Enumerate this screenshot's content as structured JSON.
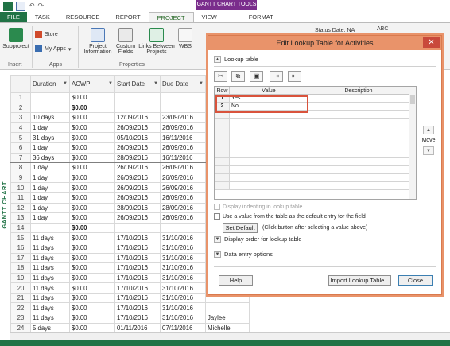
{
  "ribbon": {
    "contextual_tab": "GANTT CHART TOOLS",
    "tabs": [
      "FILE",
      "TASK",
      "RESOURCE",
      "REPORT",
      "PROJECT",
      "VIEW",
      "FORMAT"
    ],
    "active_tab": "PROJECT",
    "buttons": {
      "subproject": "Subproject",
      "store": "Store",
      "my_apps": "My Apps",
      "project_information": "Project Information",
      "custom_fields": "Custom Fields",
      "links_between_projects": "Links Between Projects",
      "wbs": "WBS",
      "status_date_label": "Status Date:",
      "status_date_value": "NA",
      "abc": "ABC"
    },
    "groups": {
      "insert": "Insert",
      "apps": "Apps",
      "properties": "Properties"
    }
  },
  "grid": {
    "side_label": "GANTT CHART",
    "columns": [
      "Duration",
      "ACWP",
      "Start Date",
      "Due Date"
    ],
    "rows": [
      {
        "n": "1",
        "duration": "",
        "acwp": "$0.00",
        "start": "",
        "due": "",
        "bold": false
      },
      {
        "n": "2",
        "duration": "",
        "acwp": "$0.00",
        "start": "",
        "due": "",
        "bold": true
      },
      {
        "n": "3",
        "duration": "10 days",
        "acwp": "$0.00",
        "start": "12/09/2016",
        "due": "23/09/2016",
        "bold": false
      },
      {
        "n": "4",
        "duration": "1 day",
        "acwp": "$0.00",
        "start": "26/09/2016",
        "due": "26/09/2016",
        "bold": false
      },
      {
        "n": "5",
        "duration": "31 days",
        "acwp": "$0.00",
        "start": "05/10/2016",
        "due": "16/11/2016",
        "bold": false
      },
      {
        "n": "6",
        "duration": "1 day",
        "acwp": "$0.00",
        "start": "26/09/2016",
        "due": "26/09/2016",
        "bold": false
      },
      {
        "n": "7",
        "duration": "36 days",
        "acwp": "$0.00",
        "start": "28/09/2016",
        "due": "16/11/2016",
        "bold": false
      },
      {
        "n": "8",
        "duration": "1 day",
        "acwp": "$0.00",
        "start": "26/09/2016",
        "due": "26/09/2016",
        "bold": false
      },
      {
        "n": "9",
        "duration": "1 day",
        "acwp": "$0.00",
        "start": "26/09/2016",
        "due": "26/09/2016",
        "bold": false
      },
      {
        "n": "10",
        "duration": "1 day",
        "acwp": "$0.00",
        "start": "26/09/2016",
        "due": "26/09/2016",
        "bold": false
      },
      {
        "n": "11",
        "duration": "1 day",
        "acwp": "$0.00",
        "start": "26/09/2016",
        "due": "26/09/2016",
        "bold": false
      },
      {
        "n": "12",
        "duration": "1 day",
        "acwp": "$0.00",
        "start": "28/09/2016",
        "due": "28/09/2016",
        "bold": false
      },
      {
        "n": "13",
        "duration": "1 day",
        "acwp": "$0.00",
        "start": "26/09/2016",
        "due": "26/09/2016",
        "bold": false
      },
      {
        "n": "14",
        "duration": "",
        "acwp": "$0.00",
        "start": "",
        "due": "",
        "bold": true
      },
      {
        "n": "15",
        "duration": "11 days",
        "acwp": "$0.00",
        "start": "17/10/2016",
        "due": "31/10/2016",
        "bold": false
      },
      {
        "n": "16",
        "duration": "11 days",
        "acwp": "$0.00",
        "start": "17/10/2016",
        "due": "31/10/2016",
        "bold": false
      },
      {
        "n": "17",
        "duration": "11 days",
        "acwp": "$0.00",
        "start": "17/10/2016",
        "due": "31/10/2016",
        "bold": false
      },
      {
        "n": "18",
        "duration": "11 days",
        "acwp": "$0.00",
        "start": "17/10/2016",
        "due": "31/10/2016",
        "bold": false
      },
      {
        "n": "19",
        "duration": "11 days",
        "acwp": "$0.00",
        "start": "17/10/2016",
        "due": "31/10/2016",
        "bold": false
      },
      {
        "n": "20",
        "duration": "11 days",
        "acwp": "$0.00",
        "start": "17/10/2016",
        "due": "31/10/2016",
        "bold": false
      },
      {
        "n": "21",
        "duration": "11 days",
        "acwp": "$0.00",
        "start": "17/10/2016",
        "due": "31/10/2016",
        "bold": false
      },
      {
        "n": "22",
        "duration": "11 days",
        "acwp": "$0.00",
        "start": "17/10/2016",
        "due": "31/10/2016",
        "bold": false
      },
      {
        "n": "23",
        "duration": "11 days",
        "acwp": "$0.00",
        "start": "17/10/2016",
        "due": "31/10/2016",
        "bold": false
      },
      {
        "n": "24",
        "duration": "5 days",
        "acwp": "$0.00",
        "start": "01/11/2016",
        "due": "07/11/2016",
        "bold": false
      }
    ],
    "selected_row": "7",
    "extra_names": {
      "23": "Jaylee",
      "24": "Michelle"
    }
  },
  "dialog": {
    "title": "Edit Lookup Table for Activities",
    "close_glyph": "✕",
    "lookup_table_label": "Lookup table",
    "table_headers": {
      "row": "Row",
      "value": "Value",
      "description": "Description"
    },
    "entries": [
      {
        "row": "1",
        "value": "Yes",
        "description": ""
      },
      {
        "row": "2",
        "value": "No",
        "description": ""
      }
    ],
    "move_label": "Move",
    "display_indenting": "Display indenting in lookup table",
    "use_default": "Use a value from the table as the default entry for the field",
    "set_default": "Set Default",
    "set_default_note": "(Click button after selecting a value above)",
    "display_order": "Display order for lookup table",
    "data_entry_options": "Data entry options",
    "help": "Help",
    "import": "Import Lookup Table...",
    "close": "Close"
  }
}
